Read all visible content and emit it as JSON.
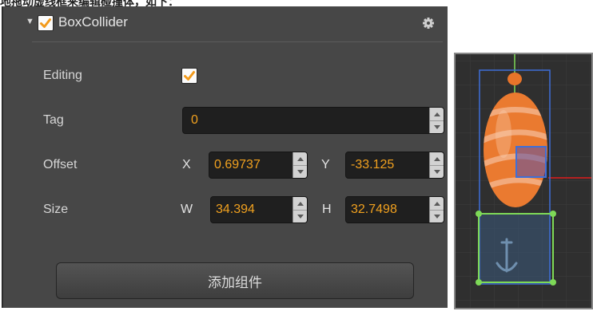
{
  "caption": "地拖动虚线框来编辑碰撞体，如下：",
  "component": {
    "title": "BoxCollider",
    "enabled": true,
    "icons": {
      "collapse": "triangle-down-icon",
      "settings": "gear-icon"
    }
  },
  "properties": {
    "editing": {
      "label": "Editing",
      "checked": true
    },
    "tag": {
      "label": "Tag",
      "value": "0"
    },
    "offset": {
      "label": "Offset",
      "x_label": "X",
      "x_value": "0.69737",
      "y_label": "Y",
      "y_value": "-33.125"
    },
    "size": {
      "label": "Size",
      "w_label": "W",
      "w_value": "34.394",
      "h_label": "H",
      "h_value": "32.7498"
    }
  },
  "add_component_button": "添加组件",
  "colors": {
    "panel_bg": "#474747",
    "field_bg": "#1f1f1f",
    "value_text": "#f1a11f",
    "checkbox_check": "#f29a1b",
    "collider_box": "#3e6fd8",
    "selection_green": "#7ed957",
    "axis_red": "#e01b1b"
  }
}
